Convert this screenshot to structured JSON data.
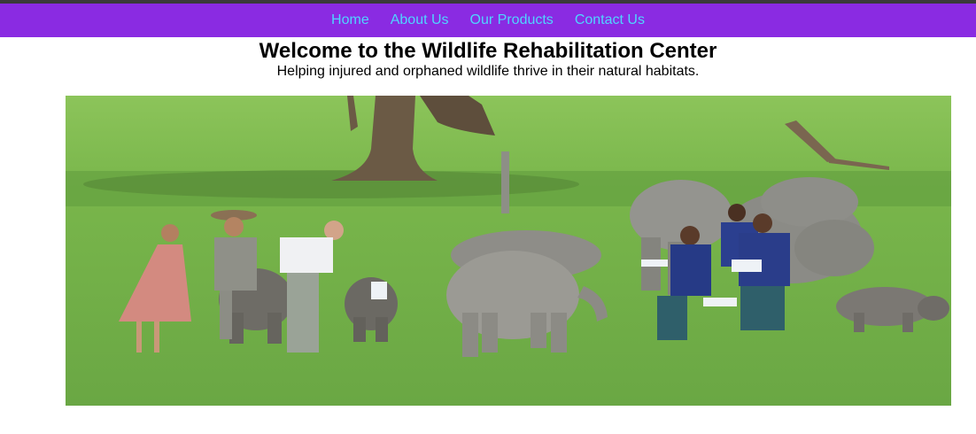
{
  "nav": {
    "items": [
      {
        "label": "Home"
      },
      {
        "label": "About Us"
      },
      {
        "label": "Our Products"
      },
      {
        "label": "Contact Us"
      }
    ]
  },
  "hero": {
    "title": "Welcome to the Wildlife Rehabilitation Center",
    "subtitle": "Helping injured and orphaned wildlife thrive in their natural habitats."
  },
  "image": {
    "subject": "people bottle-feeding baby elephants and a young rhino on a grassy field",
    "alt": "Caretakers feeding young elephants"
  },
  "colors": {
    "navbar_bg": "#8a2be2",
    "nav_link": "#4fd5ff",
    "top_strip": "#3a3a3a"
  }
}
